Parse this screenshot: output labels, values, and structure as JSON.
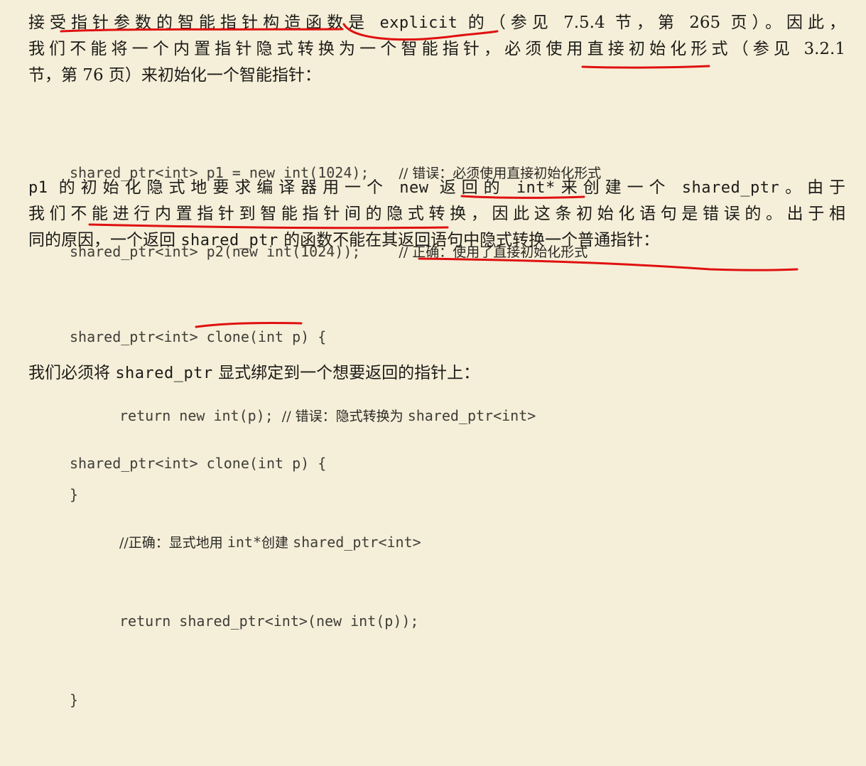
{
  "p1": {
    "l1": {
      "a": "接受指针参数的智能指针构造函数是 ",
      "code": "explicit",
      "b": " 的（参见 7.5.4 节，第 265 页）。因此，"
    },
    "l2": "我们不能将一个内置指针隐式转换为一个智能指针，必须使用直接初始化形式（参见 3.2.1",
    "l3": "节，第 76 页）来初始化一个智能指针："
  },
  "code1": {
    "l1": {
      "code": "shared_ptr<int> p1 = new int(1024);",
      "comment": "// 错误：必须使用直接初始化形式"
    },
    "l2": {
      "code": "shared_ptr<int> p2(new int(1024));",
      "comment": "// 正确：使用了直接初始化形式"
    }
  },
  "p2": {
    "l1": {
      "c1": "p1",
      "a": " 的初始化隐式地要求编译器用一个 ",
      "c2": "new",
      "b": " 返回的 ",
      "c3": "int*",
      "c": "来创建一个 ",
      "c4": "shared_ptr",
      "d": "。由于"
    },
    "l2": "我们不能进行内置指针到智能指针间的隐式转换，因此这条初始化语句是错误的。出于相",
    "l3": {
      "a": "同的原因，一个返回 ",
      "code": "shared_ptr",
      "b": " 的函数不能在其返回语句中隐式转换一个普通指针："
    }
  },
  "code2": {
    "l1": "shared_ptr<int> clone(int p) {",
    "l2_code": "return new int(p);",
    "l2_comment_a": "// 错误：隐式转换为 ",
    "l2_comment_code": "shared_ptr<int>",
    "l3": "}"
  },
  "p3": {
    "a": "我们必须将 ",
    "code": "shared_ptr",
    "b": " 显式绑定到一个想要返回的指针上："
  },
  "code3": {
    "l1": "shared_ptr<int> clone(int p) {",
    "l2_a": "//正确：显式地用 ",
    "l2_code1": "int*",
    "l2_b": "创建 ",
    "l2_code2": "shared_ptr<int>",
    "l3": "return shared_ptr<int>(new int(p));",
    "l4": "}"
  },
  "colors": {
    "background": "#f5efd9",
    "text": "#1c1b18",
    "code": "#3f3d38",
    "annotation": "#e01010"
  }
}
